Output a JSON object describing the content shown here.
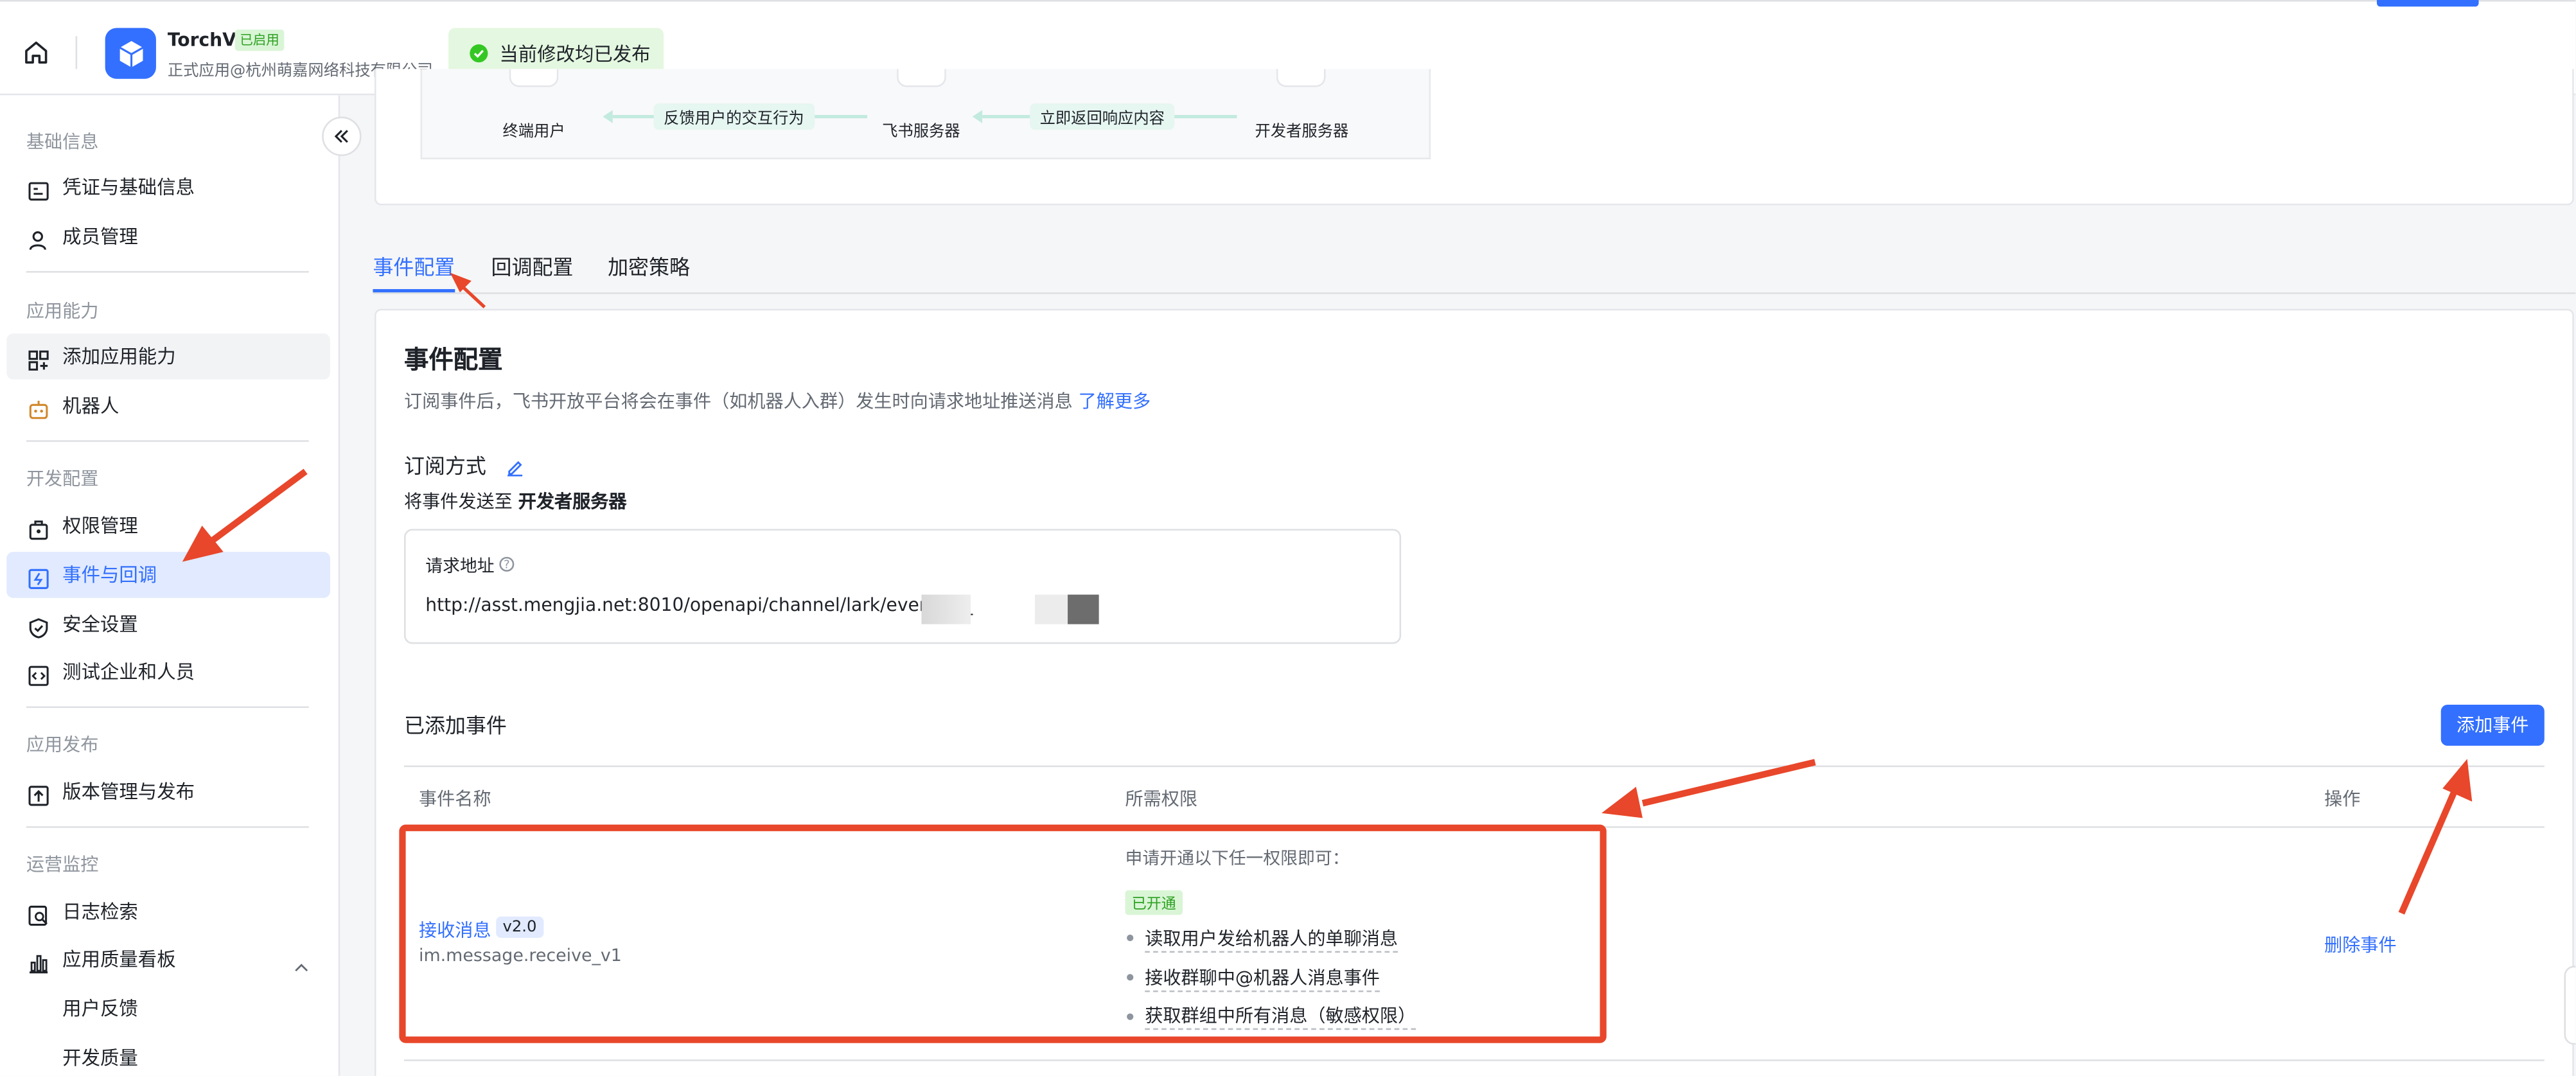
{
  "app": {
    "name": "TorchV",
    "status_badge": "已启用",
    "subtitle": "正式应用@杭州萌嘉网络科技有限公司",
    "toast": "当前修改均已发布"
  },
  "diagram": {
    "nodes": [
      "终端用户",
      "飞书服务器",
      "开发者服务器"
    ],
    "labels": [
      "反馈用户的交互行为",
      "立即返回响应内容"
    ]
  },
  "sidebar": {
    "groups": [
      {
        "title": "基础信息",
        "items": [
          {
            "label": "凭证与基础信息",
            "icon": "credential-icon"
          },
          {
            "label": "成员管理",
            "icon": "member-icon"
          }
        ]
      },
      {
        "title": "应用能力",
        "items": [
          {
            "label": "添加应用能力",
            "icon": "add-ability-icon"
          },
          {
            "label": "机器人",
            "icon": "robot-icon"
          }
        ]
      },
      {
        "title": "开发配置",
        "items": [
          {
            "label": "权限管理",
            "icon": "permission-icon"
          },
          {
            "label": "事件与回调",
            "icon": "event-icon"
          },
          {
            "label": "安全设置",
            "icon": "shield-icon"
          },
          {
            "label": "测试企业和人员",
            "icon": "code-icon"
          }
        ]
      },
      {
        "title": "应用发布",
        "items": [
          {
            "label": "版本管理与发布",
            "icon": "upload-icon"
          }
        ]
      },
      {
        "title": "运营监控",
        "items": [
          {
            "label": "日志检索",
            "icon": "log-search-icon"
          },
          {
            "label": "应用质量看板",
            "icon": "chart-icon"
          },
          {
            "label": "用户反馈",
            "icon": ""
          },
          {
            "label": "开发质量",
            "icon": ""
          }
        ]
      }
    ]
  },
  "tabs": [
    "事件配置",
    "回调配置",
    "加密策略"
  ],
  "event_config": {
    "title": "事件配置",
    "description": "订阅事件后，飞书开放平台将会在事件（如机器人入群）发生时向请求地址推送消息",
    "learn_more": "了解更多",
    "subscribe_title": "订阅方式",
    "send_to_prefix": "将事件发送至",
    "send_to_target": "开发者服务器",
    "request_url_label": "请求地址",
    "request_url": "http://asst.mengjia.net:8010/openapi/channel/lark/event/cli_",
    "added_events_title": "已添加事件",
    "add_event_button": "添加事件"
  },
  "table": {
    "headers": [
      "事件名称",
      "所需权限",
      "操作"
    ],
    "rows": [
      {
        "event_name": "接收消息",
        "version": "v2.0",
        "event_id": "im.message.receive_v1",
        "perm_head": "申请开通以下任一权限即可：",
        "perm_badge": "已开通",
        "permissions": [
          "读取用户发给机器人的单聊消息",
          "接收群聊中@机器人消息事件",
          "获取群组中所有消息（敏感权限）"
        ],
        "action": "删除事件"
      }
    ]
  },
  "colors": {
    "accent": "#3370ff",
    "annotation_red": "#e8472b",
    "success_green": "#34c724"
  }
}
